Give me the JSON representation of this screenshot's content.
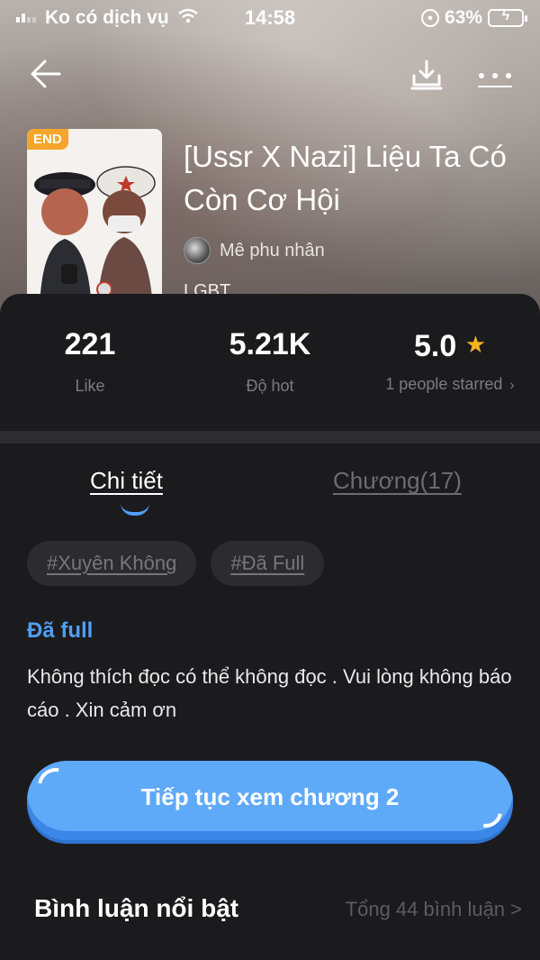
{
  "status_bar": {
    "carrier": "Ko có dịch vụ",
    "time": "14:58",
    "battery": "63%",
    "battery_level": 0.63,
    "icons": [
      "signal-icon",
      "wifi-icon",
      "rotation-lock-icon",
      "battery-charging-icon"
    ]
  },
  "topbar": {
    "icons": [
      "back-arrow-icon",
      "download-icon",
      "more-icon"
    ]
  },
  "book": {
    "badge": "END",
    "title": "[Ussr X Nazi] Liệu Ta Có Còn Cơ Hội",
    "author": "Mê phu nhân",
    "genre": "LGBT"
  },
  "stats": {
    "likes_value": "221",
    "likes_label": "Like",
    "hot_value": "5.21K",
    "hot_label": "Độ hot",
    "rating_value": "5.0",
    "rating_label": "1 people starred",
    "rating_chevron": "›"
  },
  "tabs": {
    "detail": "Chi tiết",
    "chapters": "Chương(17)",
    "active": "detail"
  },
  "tags": [
    "#Xuyên Không",
    "#Đã Full"
  ],
  "detail": {
    "status": "Đã full",
    "description": "Không thích đọc có thể không đọc . Vui lòng không báo cáo . Xin cảm ơn"
  },
  "continue_button": "Tiếp tục xem chương 2",
  "comments": {
    "title": "Bình luận nổi bật",
    "count": "Tổng 44 bình luận >"
  },
  "colors": {
    "accent": "#4f9ff7",
    "button": "#5fa9f9",
    "badge": "#f5a52b",
    "star": "#f7b223",
    "background": "#1b1b1d"
  }
}
